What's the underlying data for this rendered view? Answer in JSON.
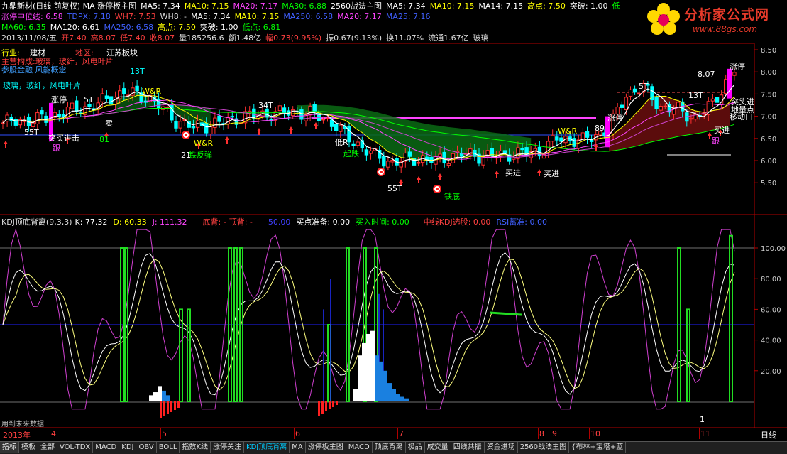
{
  "header": {
    "line1": [
      {
        "t": "九鼎新材(日线 前复权) MA 涨停板主图",
        "c": "#ffffff"
      },
      {
        "t": "MA5: 7.34",
        "c": "#ffffff"
      },
      {
        "t": "MA10: 7.15",
        "c": "#ffff00"
      },
      {
        "t": "MA20: 7.17",
        "c": "#ff44ff"
      },
      {
        "t": "MA30: 6.88",
        "c": "#00ff00"
      },
      {
        "t": "2560战法主图",
        "c": "#ffffff"
      },
      {
        "t": "MA5: 7.34",
        "c": "#ffffff"
      },
      {
        "t": "MA10: 7.15",
        "c": "#ffff00"
      },
      {
        "t": "MA14: 7.15",
        "c": "#ffffff"
      },
      {
        "t": "高点: 7.50",
        "c": "#ffff00"
      },
      {
        "t": "突破: 1.00",
        "c": "#ffffff"
      },
      {
        "t": "低",
        "c": "#00ff00"
      }
    ],
    "line2": [
      {
        "t": "涨停中位线: 6.58",
        "c": "#ff44ff"
      },
      {
        "t": "TDPX: 7.18",
        "c": "#4060ff"
      },
      {
        "t": "WH7: 7.53",
        "c": "#ff4040"
      },
      {
        "t": "WH8: -",
        "c": "#dddddd"
      },
      {
        "t": "MA5: 7.34",
        "c": "#ffffff"
      },
      {
        "t": "MA10: 7.15",
        "c": "#ffff00"
      },
      {
        "t": "MA250: 6.58",
        "c": "#4060ff"
      },
      {
        "t": "MA20: 7.17",
        "c": "#ff44ff"
      },
      {
        "t": "MA25: 7.16",
        "c": "#4060ff"
      }
    ],
    "line3": [
      {
        "t": "MA60: 6.35",
        "c": "#00ff00"
      },
      {
        "t": "MA120: 6.61",
        "c": "#ffffff"
      },
      {
        "t": "MA250: 6.58",
        "c": "#4060ff"
      },
      {
        "t": "高点: 7.50",
        "c": "#ffff00"
      },
      {
        "t": "突破: 1.00",
        "c": "#ffffff"
      },
      {
        "t": "低点: 6.81",
        "c": "#00ff00"
      }
    ],
    "line4": [
      {
        "t": "2013/11/08/五",
        "c": "#dddddd"
      },
      {
        "t": "开7.40",
        "c": "#ff4040"
      },
      {
        "t": "高8.07",
        "c": "#ff4040"
      },
      {
        "t": "低7.40",
        "c": "#ff4040"
      },
      {
        "t": "收8.07",
        "c": "#ff4040"
      },
      {
        "t": "量185256.6",
        "c": "#dddddd"
      },
      {
        "t": "额1.48亿",
        "c": "#dddddd"
      },
      {
        "t": "幅0.73(9.95%)",
        "c": "#ff4040"
      },
      {
        "t": "振0.67(9.13%)",
        "c": "#dddddd"
      },
      {
        "t": "换11.07%",
        "c": "#dddddd"
      },
      {
        "t": "流通1.67亿",
        "c": "#dddddd"
      },
      {
        "t": "玻璃",
        "c": "#dddddd"
      }
    ]
  },
  "info": {
    "industry_label": "行业:",
    "industry_value": "建材",
    "region_label": "地区:",
    "region_value": "江苏板块",
    "main_business": "主营构成:玻璃，玻纤，风电叶片",
    "concept": "参股金融 风能概念",
    "business_tag": "玻璃，玻纤，风电叶片"
  },
  "logo": {
    "name": "分析家公式网",
    "url": "www.88gs.com"
  },
  "price_axis": [
    "8.50",
    "8.00",
    "7.50",
    "7.00",
    "6.50",
    "6.00",
    "5.50"
  ],
  "indicator_axis": [
    "100.00",
    "80.00",
    "60.00",
    "40.00",
    "20.00"
  ],
  "indicator_header": [
    {
      "t": "KDJ顶底背离(9,3,3)",
      "c": "#dddddd"
    },
    {
      "t": "K: 77.32",
      "c": "#ffffff"
    },
    {
      "t": "D: 60.33",
      "c": "#ffff00"
    },
    {
      "t": "J: 111.32",
      "c": "#ff44ff"
    },
    {
      "t": "底背: -",
      "c": "#ff4040"
    },
    {
      "t": "顶背: -",
      "c": "#ff4040"
    },
    {
      "t": "50.00",
      "c": "#4040ff"
    },
    {
      "t": "买点准备: 0.00",
      "c": "#ffffff"
    },
    {
      "t": "买入时间: 0.00",
      "c": "#00ff00"
    },
    {
      "t": "中线KDJ选股: 0.00",
      "c": "#ff4040"
    },
    {
      "t": "RSI蓄准: 0.00",
      "c": "#4060ff"
    }
  ],
  "chart_labels": [
    {
      "t": "13T",
      "c": "#00ffff"
    },
    {
      "t": "涨停",
      "c": "#ffffff"
    },
    {
      "t": "5T",
      "c": "#ffffff"
    },
    {
      "t": "W&R",
      "c": "#ffff00"
    },
    {
      "t": "55T",
      "c": "#ffffff"
    },
    {
      "t": "突买进击",
      "c": "#ffffff"
    },
    {
      "t": "81",
      "c": "#00ff00"
    },
    {
      "t": "34T",
      "c": "#ffffff"
    },
    {
      "t": "跟",
      "c": "#ff44ff"
    },
    {
      "t": "21",
      "c": "#ffffff"
    },
    {
      "t": "铁反弹",
      "c": "#00ff00"
    },
    {
      "t": "W&R",
      "c": "#ffff00"
    },
    {
      "t": "低R",
      "c": "#ffffff"
    },
    {
      "t": "起跌",
      "c": "#00ff00"
    },
    {
      "t": "55T",
      "c": "#ffffff"
    },
    {
      "t": "铁底",
      "c": "#00ff00"
    },
    {
      "t": "买进",
      "c": "#ffffff"
    },
    {
      "t": "W&R",
      "c": "#ffff00"
    },
    {
      "t": "买进",
      "c": "#ffffff"
    },
    {
      "t": "89",
      "c": "#ffffff"
    },
    {
      "t": "涨停",
      "c": "#ffffff"
    },
    {
      "t": "5T",
      "c": "#ffffff"
    },
    {
      "t": "13T",
      "c": "#ffffff"
    },
    {
      "t": "8.07",
      "c": "#ffffff"
    },
    {
      "t": "涨停",
      "c": "#ffffff"
    },
    {
      "t": "地量点",
      "c": "#ffffff"
    },
    {
      "t": "移动口",
      "c": "#ffffff"
    },
    {
      "t": "买进",
      "c": "#ffffff"
    },
    {
      "t": "突头进",
      "c": "#ffffff"
    },
    {
      "t": "跟",
      "c": "#ff44ff"
    },
    {
      "t": "卖",
      "c": "#ffffff"
    },
    {
      "t": "1",
      "c": "#ffffff"
    }
  ],
  "future_data_note": "用到未来数据",
  "time_axis": [
    {
      "t": "2013年",
      "c": "#ff4040"
    },
    {
      "t": "4",
      "c": "#ff4040"
    },
    {
      "t": "5",
      "c": "#ff4040"
    },
    {
      "t": "6",
      "c": "#ff4040"
    },
    {
      "t": "7",
      "c": "#ff4040"
    },
    {
      "t": "8",
      "c": "#ff4040"
    },
    {
      "t": "9",
      "c": "#ff4040"
    },
    {
      "t": "10",
      "c": "#ff4040"
    },
    {
      "t": "11",
      "c": "#ff4040"
    },
    {
      "t": "日线",
      "c": "#ffffff"
    }
  ],
  "tabs": [
    "指标",
    "模板",
    "全部",
    "VOL-TDX",
    "MACD",
    "KDJ",
    "OBV",
    "BOLL",
    "指数K线",
    "涨停关注",
    "KDJ顶底背离",
    "MA",
    "涨停板主图",
    "MACD",
    "顶底背离",
    "极品",
    "成交量",
    "四线共振",
    "资金进场",
    "2560战法主图",
    "{布林+宝塔+蓝"
  ],
  "active_tab": 10,
  "colors": {
    "up": "#ff3030",
    "down": "#00ffff",
    "ma5": "#ffffff",
    "ma10": "#ffff00",
    "ma20": "#ff44ff",
    "ma30": "#00ff00",
    "axis": "#b00000"
  }
}
